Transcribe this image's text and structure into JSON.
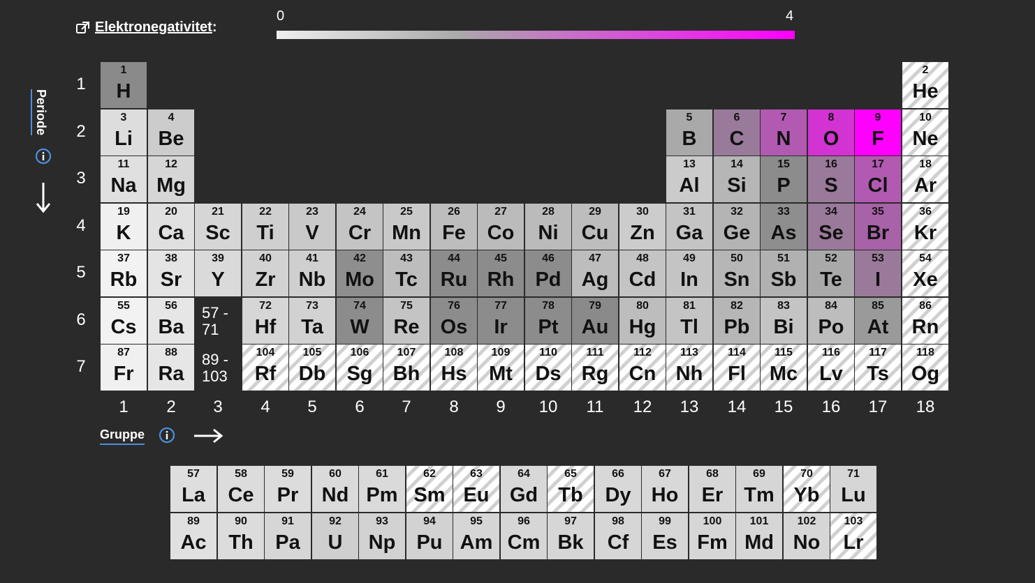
{
  "legend": {
    "title": "Elektronegativitet",
    "colon": ":",
    "scale_min": "0",
    "scale_max": "4",
    "color_low": "#eeeeee",
    "color_high": "#ff00ff"
  },
  "axes": {
    "period_label": "Periode",
    "group_label": "Gruppe",
    "periods": [
      "1",
      "2",
      "3",
      "4",
      "5",
      "6",
      "7"
    ],
    "groups": [
      "1",
      "2",
      "3",
      "4",
      "5",
      "6",
      "7",
      "8",
      "9",
      "10",
      "11",
      "12",
      "13",
      "14",
      "15",
      "16",
      "17",
      "18"
    ]
  },
  "icons": {
    "external_link": "external-link-icon",
    "info": "info-icon",
    "arrow_down": "arrow-down-icon",
    "arrow_right": "arrow-right-icon"
  },
  "placeholders": [
    {
      "label_top": "57 -",
      "label_bottom": "71",
      "row": 6,
      "col": 3
    },
    {
      "label_top": "89 -",
      "label_bottom": "103",
      "row": 7,
      "col": 3
    }
  ],
  "elements": [
    {
      "n": "1",
      "s": "H",
      "row": 1,
      "col": 1,
      "shade": "#8a8a8a"
    },
    {
      "n": "2",
      "s": "He",
      "row": 1,
      "col": 18,
      "hatch": true
    },
    {
      "n": "3",
      "s": "Li",
      "row": 2,
      "col": 1,
      "shade": "#dddddd"
    },
    {
      "n": "4",
      "s": "Be",
      "row": 2,
      "col": 2,
      "shade": "#cccccc"
    },
    {
      "n": "5",
      "s": "B",
      "row": 2,
      "col": 13,
      "shade": "#a9a9a9"
    },
    {
      "n": "6",
      "s": "C",
      "row": 2,
      "col": 14,
      "shade": "#9a7a9a"
    },
    {
      "n": "7",
      "s": "N",
      "row": 2,
      "col": 15,
      "shade": "#b25ab2"
    },
    {
      "n": "8",
      "s": "O",
      "row": 2,
      "col": 16,
      "shade": "#d233d2"
    },
    {
      "n": "9",
      "s": "F",
      "row": 2,
      "col": 17,
      "shade": "#ff00ff"
    },
    {
      "n": "10",
      "s": "Ne",
      "row": 2,
      "col": 18,
      "hatch": true
    },
    {
      "n": "11",
      "s": "Na",
      "row": 3,
      "col": 1,
      "shade": "#e0e0e0"
    },
    {
      "n": "12",
      "s": "Mg",
      "row": 3,
      "col": 2,
      "shade": "#d6d6d6"
    },
    {
      "n": "13",
      "s": "Al",
      "row": 3,
      "col": 13,
      "shade": "#cbcbcb"
    },
    {
      "n": "14",
      "s": "Si",
      "row": 3,
      "col": 14,
      "shade": "#b6b6b6"
    },
    {
      "n": "15",
      "s": "P",
      "row": 3,
      "col": 15,
      "shade": "#8c8c8c"
    },
    {
      "n": "16",
      "s": "S",
      "row": 3,
      "col": 16,
      "shade": "#9a7a9a"
    },
    {
      "n": "17",
      "s": "Cl",
      "row": 3,
      "col": 17,
      "shade": "#b25ab2"
    },
    {
      "n": "18",
      "s": "Ar",
      "row": 3,
      "col": 18,
      "hatch": true
    },
    {
      "n": "19",
      "s": "K",
      "row": 4,
      "col": 1,
      "shade": "#f0f0f0"
    },
    {
      "n": "20",
      "s": "Ca",
      "row": 4,
      "col": 2,
      "shade": "#e0e0e0"
    },
    {
      "n": "21",
      "s": "Sc",
      "row": 4,
      "col": 3,
      "shade": "#d6d6d6"
    },
    {
      "n": "22",
      "s": "Ti",
      "row": 4,
      "col": 4,
      "shade": "#cfcfcf"
    },
    {
      "n": "23",
      "s": "V",
      "row": 4,
      "col": 5,
      "shade": "#c9c9c9"
    },
    {
      "n": "24",
      "s": "Cr",
      "row": 4,
      "col": 6,
      "shade": "#c4c4c4"
    },
    {
      "n": "25",
      "s": "Mn",
      "row": 4,
      "col": 7,
      "shade": "#c9c9c9"
    },
    {
      "n": "26",
      "s": "Fe",
      "row": 4,
      "col": 8,
      "shade": "#bdbdbd"
    },
    {
      "n": "27",
      "s": "Co",
      "row": 4,
      "col": 9,
      "shade": "#bbbbbb"
    },
    {
      "n": "28",
      "s": "Ni",
      "row": 4,
      "col": 10,
      "shade": "#bbbbbb"
    },
    {
      "n": "29",
      "s": "Cu",
      "row": 4,
      "col": 11,
      "shade": "#bdbdbd"
    },
    {
      "n": "30",
      "s": "Zn",
      "row": 4,
      "col": 12,
      "shade": "#cccccc"
    },
    {
      "n": "31",
      "s": "Ga",
      "row": 4,
      "col": 13,
      "shade": "#c4c4c4"
    },
    {
      "n": "32",
      "s": "Ge",
      "row": 4,
      "col": 14,
      "shade": "#b4b4b4"
    },
    {
      "n": "33",
      "s": "As",
      "row": 4,
      "col": 15,
      "shade": "#8e8e8e"
    },
    {
      "n": "34",
      "s": "Se",
      "row": 4,
      "col": 16,
      "shade": "#9a7a9a"
    },
    {
      "n": "35",
      "s": "Br",
      "row": 4,
      "col": 17,
      "shade": "#a862a8"
    },
    {
      "n": "36",
      "s": "Kr",
      "row": 4,
      "col": 18,
      "hatch": true
    },
    {
      "n": "37",
      "s": "Rb",
      "row": 5,
      "col": 1,
      "shade": "#f2f2f2"
    },
    {
      "n": "38",
      "s": "Sr",
      "row": 5,
      "col": 2,
      "shade": "#e4e4e4"
    },
    {
      "n": "39",
      "s": "Y",
      "row": 5,
      "col": 3,
      "shade": "#dadada"
    },
    {
      "n": "40",
      "s": "Zr",
      "row": 5,
      "col": 4,
      "shade": "#d2d2d2"
    },
    {
      "n": "41",
      "s": "Nb",
      "row": 5,
      "col": 5,
      "shade": "#cfcfcf"
    },
    {
      "n": "42",
      "s": "Mo",
      "row": 5,
      "col": 6,
      "shade": "#8e8e8e"
    },
    {
      "n": "43",
      "s": "Tc",
      "row": 5,
      "col": 7,
      "shade": "#bdbdbd"
    },
    {
      "n": "44",
      "s": "Ru",
      "row": 5,
      "col": 8,
      "shade": "#8c8c8c"
    },
    {
      "n": "45",
      "s": "Rh",
      "row": 5,
      "col": 9,
      "shade": "#8c8c8c"
    },
    {
      "n": "46",
      "s": "Pd",
      "row": 5,
      "col": 10,
      "shade": "#8c8c8c"
    },
    {
      "n": "47",
      "s": "Ag",
      "row": 5,
      "col": 11,
      "shade": "#bdbdbd"
    },
    {
      "n": "48",
      "s": "Cd",
      "row": 5,
      "col": 12,
      "shade": "#c4c4c4"
    },
    {
      "n": "49",
      "s": "In",
      "row": 5,
      "col": 13,
      "shade": "#c4c4c4"
    },
    {
      "n": "50",
      "s": "Sn",
      "row": 5,
      "col": 14,
      "shade": "#b6b6b6"
    },
    {
      "n": "51",
      "s": "Sb",
      "row": 5,
      "col": 15,
      "shade": "#b1b1b1"
    },
    {
      "n": "52",
      "s": "Te",
      "row": 5,
      "col": 16,
      "shade": "#a9a9a9"
    },
    {
      "n": "53",
      "s": "I",
      "row": 5,
      "col": 17,
      "shade": "#9a7a9a"
    },
    {
      "n": "54",
      "s": "Xe",
      "row": 5,
      "col": 18,
      "hatch": true
    },
    {
      "n": "55",
      "s": "Cs",
      "row": 6,
      "col": 1,
      "shade": "#f2f2f2"
    },
    {
      "n": "56",
      "s": "Ba",
      "row": 6,
      "col": 2,
      "shade": "#e6e6e6"
    },
    {
      "n": "72",
      "s": "Hf",
      "row": 6,
      "col": 4,
      "shade": "#d6d6d6"
    },
    {
      "n": "73",
      "s": "Ta",
      "row": 6,
      "col": 5,
      "shade": "#d2d2d2"
    },
    {
      "n": "74",
      "s": "W",
      "row": 6,
      "col": 6,
      "shade": "#8c8c8c"
    },
    {
      "n": "75",
      "s": "Re",
      "row": 6,
      "col": 7,
      "shade": "#c4c4c4"
    },
    {
      "n": "76",
      "s": "Os",
      "row": 6,
      "col": 8,
      "shade": "#8c8c8c"
    },
    {
      "n": "77",
      "s": "Ir",
      "row": 6,
      "col": 9,
      "shade": "#8c8c8c"
    },
    {
      "n": "78",
      "s": "Pt",
      "row": 6,
      "col": 10,
      "shade": "#8c8c8c"
    },
    {
      "n": "79",
      "s": "Au",
      "row": 6,
      "col": 11,
      "shade": "#8a8a8a"
    },
    {
      "n": "80",
      "s": "Hg",
      "row": 6,
      "col": 12,
      "shade": "#bdbdbd"
    },
    {
      "n": "81",
      "s": "Tl",
      "row": 6,
      "col": 13,
      "shade": "#c4c4c4"
    },
    {
      "n": "82",
      "s": "Pb",
      "row": 6,
      "col": 14,
      "shade": "#b6b6b6"
    },
    {
      "n": "83",
      "s": "Bi",
      "row": 6,
      "col": 15,
      "shade": "#c4c4c4"
    },
    {
      "n": "84",
      "s": "Po",
      "row": 6,
      "col": 16,
      "shade": "#bdbdbd"
    },
    {
      "n": "85",
      "s": "At",
      "row": 6,
      "col": 17,
      "shade": "#9a9a9a"
    },
    {
      "n": "86",
      "s": "Rn",
      "row": 6,
      "col": 18,
      "hatch": true
    },
    {
      "n": "87",
      "s": "Fr",
      "row": 7,
      "col": 1,
      "shade": "#f0f0f0"
    },
    {
      "n": "88",
      "s": "Ra",
      "row": 7,
      "col": 2,
      "shade": "#e6e6e6"
    },
    {
      "n": "104",
      "s": "Rf",
      "row": 7,
      "col": 4,
      "hatch": true
    },
    {
      "n": "105",
      "s": "Db",
      "row": 7,
      "col": 5,
      "hatch": true
    },
    {
      "n": "106",
      "s": "Sg",
      "row": 7,
      "col": 6,
      "hatch": true
    },
    {
      "n": "107",
      "s": "Bh",
      "row": 7,
      "col": 7,
      "hatch": true
    },
    {
      "n": "108",
      "s": "Hs",
      "row": 7,
      "col": 8,
      "hatch": true
    },
    {
      "n": "109",
      "s": "Mt",
      "row": 7,
      "col": 9,
      "hatch": true
    },
    {
      "n": "110",
      "s": "Ds",
      "row": 7,
      "col": 10,
      "hatch": true
    },
    {
      "n": "111",
      "s": "Rg",
      "row": 7,
      "col": 11,
      "hatch": true
    },
    {
      "n": "112",
      "s": "Cn",
      "row": 7,
      "col": 12,
      "hatch": true
    },
    {
      "n": "113",
      "s": "Nh",
      "row": 7,
      "col": 13,
      "hatch": true
    },
    {
      "n": "114",
      "s": "Fl",
      "row": 7,
      "col": 14,
      "hatch": true
    },
    {
      "n": "115",
      "s": "Mc",
      "row": 7,
      "col": 15,
      "hatch": true
    },
    {
      "n": "116",
      "s": "Lv",
      "row": 7,
      "col": 16,
      "hatch": true
    },
    {
      "n": "117",
      "s": "Ts",
      "row": 7,
      "col": 17,
      "hatch": true
    },
    {
      "n": "118",
      "s": "Og",
      "row": 7,
      "col": 18,
      "hatch": true
    }
  ],
  "lanthanides": [
    {
      "n": "57",
      "s": "La",
      "shade": "#dedede"
    },
    {
      "n": "58",
      "s": "Ce",
      "shade": "#dcdcdc"
    },
    {
      "n": "59",
      "s": "Pr",
      "shade": "#dcdcdc"
    },
    {
      "n": "60",
      "s": "Nd",
      "shade": "#dadada"
    },
    {
      "n": "61",
      "s": "Pm",
      "shade": "#dadada"
    },
    {
      "n": "62",
      "s": "Sm",
      "hatch": true
    },
    {
      "n": "63",
      "s": "Eu",
      "hatch": true
    },
    {
      "n": "64",
      "s": "Gd",
      "shade": "#d8d8d8"
    },
    {
      "n": "65",
      "s": "Tb",
      "hatch": true
    },
    {
      "n": "66",
      "s": "Dy",
      "shade": "#d8d8d8"
    },
    {
      "n": "67",
      "s": "Ho",
      "shade": "#d8d8d8"
    },
    {
      "n": "68",
      "s": "Er",
      "shade": "#d6d6d6"
    },
    {
      "n": "69",
      "s": "Tm",
      "shade": "#d6d6d6"
    },
    {
      "n": "70",
      "s": "Yb",
      "hatch": true
    },
    {
      "n": "71",
      "s": "Lu",
      "shade": "#d6d6d6"
    }
  ],
  "actinides": [
    {
      "n": "89",
      "s": "Ac",
      "shade": "#e0e0e0"
    },
    {
      "n": "90",
      "s": "Th",
      "shade": "#dcdcdc"
    },
    {
      "n": "91",
      "s": "Pa",
      "shade": "#d6d6d6"
    },
    {
      "n": "92",
      "s": "U",
      "shade": "#cfcfcf"
    },
    {
      "n": "93",
      "s": "Np",
      "shade": "#d2d2d2"
    },
    {
      "n": "94",
      "s": "Pu",
      "shade": "#d2d2d2"
    },
    {
      "n": "95",
      "s": "Am",
      "shade": "#d6d6d6"
    },
    {
      "n": "96",
      "s": "Cm",
      "shade": "#d6d6d6"
    },
    {
      "n": "97",
      "s": "Bk",
      "shade": "#d6d6d6"
    },
    {
      "n": "98",
      "s": "Cf",
      "shade": "#d6d6d6"
    },
    {
      "n": "99",
      "s": "Es",
      "shade": "#d6d6d6"
    },
    {
      "n": "100",
      "s": "Fm",
      "shade": "#d6d6d6"
    },
    {
      "n": "101",
      "s": "Md",
      "shade": "#d6d6d6"
    },
    {
      "n": "102",
      "s": "No",
      "shade": "#d6d6d6"
    },
    {
      "n": "103",
      "s": "Lr",
      "hatch": true
    }
  ]
}
